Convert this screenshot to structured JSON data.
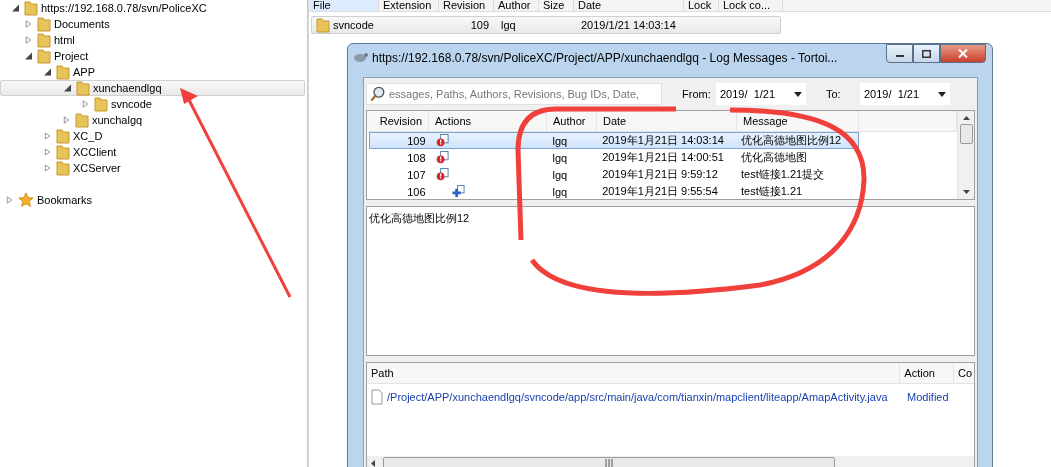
{
  "tree": {
    "root": {
      "label": "https://192.168.0.78/svn/PoliceXC",
      "expanded": true,
      "children": [
        {
          "label": "Documents",
          "expanded": false,
          "selected": false
        },
        {
          "label": "html",
          "expanded": false,
          "selected": false
        },
        {
          "label": "Project",
          "expanded": true,
          "selected": false,
          "children": [
            {
              "label": "APP",
              "expanded": true,
              "selected": false,
              "children": [
                {
                  "label": "xunchaendlgq",
                  "expanded": true,
                  "selected": true,
                  "children": [
                    {
                      "label": "svncode",
                      "expanded": false,
                      "selected": false
                    }
                  ]
                },
                {
                  "label": "xunchalgq",
                  "expanded": false,
                  "selected": false
                }
              ]
            },
            {
              "label": "XC_D",
              "expanded": false,
              "selected": false
            },
            {
              "label": "XCClient",
              "expanded": false,
              "selected": false
            },
            {
              "label": "XCServer",
              "expanded": false,
              "selected": false
            }
          ]
        }
      ]
    },
    "bookmarks": {
      "label": "Bookmarks",
      "expanded": false
    }
  },
  "file_list": {
    "columns": [
      "File",
      "Extension",
      "Revision",
      "Author",
      "Size",
      "Date",
      "Lock",
      "Lock co..."
    ],
    "rows": [
      {
        "file": "svncode",
        "revision": "109",
        "author": "lgq",
        "date": "2019/1/21 14:03:14",
        "selected": true
      }
    ]
  },
  "log_dialog": {
    "title": "https://192.168.0.78/svn/PoliceXC/Project/APP/xunchaendlgq - Log Messages - Tortoi...",
    "filter": {
      "placeholder": "essages, Paths, Authors, Revisions, Bug IDs, Date,"
    },
    "from_label": "From:",
    "from_value": "2019/  1/21",
    "to_label": "To:",
    "to_value": "2019/  1/21",
    "columns": [
      "Revision",
      "Actions",
      "Author",
      "Date",
      "Message"
    ],
    "rows": [
      {
        "revision": "109",
        "kind": "modified",
        "author": "lgq",
        "date": "2019年1月21日 14:03:14",
        "message": "优化高德地图比例12",
        "selected": true
      },
      {
        "revision": "108",
        "kind": "modified",
        "author": "lgq",
        "date": "2019年1月21日 14:00:51",
        "message": "优化高德地图",
        "selected": false
      },
      {
        "revision": "107",
        "kind": "modified",
        "author": "lgq",
        "date": "2019年1月21日 9:59:12",
        "message": "test链接1.21提交",
        "selected": false
      },
      {
        "revision": "106",
        "kind": "added",
        "author": "lgq",
        "date": "2019年1月21日 9:55:54",
        "message": "test链接1.21",
        "selected": false
      }
    ],
    "message_text": "优化高德地图比例12",
    "path_columns": [
      "Path",
      "Action",
      "Co"
    ],
    "paths": [
      {
        "path": "/Project/APP/xunchaendlgq/svncode/app/src/main/java/com/tianxin/mapclient/liteapp/AmapActivity.java",
        "action": "Modified"
      }
    ]
  }
}
